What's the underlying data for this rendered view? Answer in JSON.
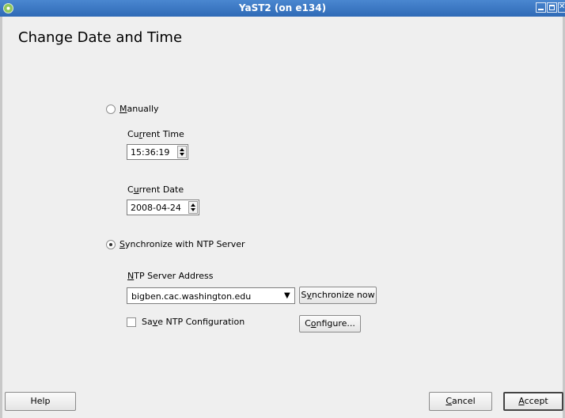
{
  "window": {
    "title": "YaST2 (on e134)"
  },
  "page": {
    "title": "Change Date and Time"
  },
  "manual": {
    "label_prefix": "",
    "label_underlined": "M",
    "label_rest": "anually",
    "selected": false,
    "current_time": {
      "label_prefix": "Cu",
      "label_underlined": "r",
      "label_rest": "rent Time",
      "value": "15:36:19"
    },
    "current_date": {
      "label_prefix": "C",
      "label_underlined": "u",
      "label_rest": "rrent Date",
      "value": "2008-04-24"
    }
  },
  "ntp": {
    "label_prefix": "",
    "label_underlined": "S",
    "label_rest": "ynchronize with NTP Server",
    "selected": true,
    "server_address": {
      "label_prefix": "",
      "label_underlined": "N",
      "label_rest": "TP Server Address",
      "value": "bigben.cac.washington.edu"
    },
    "sync_now": {
      "label_prefix": "S",
      "label_underlined": "y",
      "label_rest": "nchronize now"
    },
    "save_config": {
      "label_prefix": "Sa",
      "label_underlined": "v",
      "label_rest": "e NTP Configuration",
      "checked": false
    },
    "configure": {
      "label_prefix": "C",
      "label_underlined": "o",
      "label_rest": "nfigure..."
    }
  },
  "footer": {
    "help_label": "Help",
    "cancel": {
      "label_prefix": "",
      "label_underlined": "C",
      "label_rest": "ancel"
    },
    "accept": {
      "label_prefix": "",
      "label_underlined": "A",
      "label_rest": "ccept"
    }
  },
  "icons": {
    "app": "yast-chameleon-icon",
    "minimize": "minimize-icon",
    "maximize": "maximize-icon",
    "close": "close-icon",
    "spin": "spin-arrows-icon",
    "dropdown": "chevron-down-icon"
  },
  "colors": {
    "titlebar": "#2f6ab6",
    "window_bg": "#efefef"
  }
}
